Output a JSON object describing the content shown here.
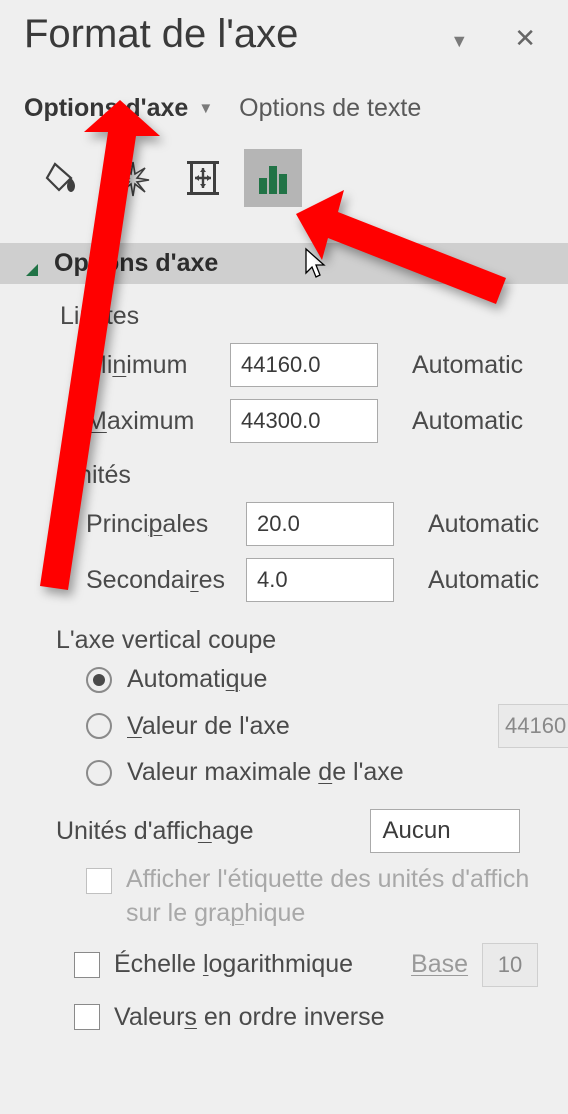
{
  "header": {
    "title": "Format de l'axe"
  },
  "tabs": {
    "axis_options": "Options d'axe",
    "text_options": "Options de texte"
  },
  "section": {
    "title": "Options d'axe"
  },
  "limits": {
    "header": "Limites",
    "min_label": "Minimum",
    "min_value": "44160.0",
    "min_auto": "Automatic",
    "max_label": "Maximum",
    "max_value": "44300.0",
    "max_auto": "Automatic"
  },
  "units": {
    "header": "Unités",
    "major_label": "Principales",
    "major_value": "20.0",
    "major_auto": "Automatic",
    "minor_label": "Secondaires",
    "minor_value": "4.0",
    "minor_auto": "Automatic"
  },
  "cross": {
    "header": "L'axe vertical coupe",
    "auto": "Automatique",
    "at_value": "Valeur de l'axe",
    "at_value_input": "44160",
    "at_max": "Valeur maximale de l'axe"
  },
  "display_units": {
    "label": "Unités d'affichage",
    "value": "Aucun",
    "show_label": "Afficher l'étiquette des unités d'affichage sur le graphique"
  },
  "log_scale": {
    "label": "Échelle logarithmique",
    "base_label": "Base",
    "base_value": "10"
  },
  "reverse": {
    "label": "Valeurs en ordre inverse"
  }
}
